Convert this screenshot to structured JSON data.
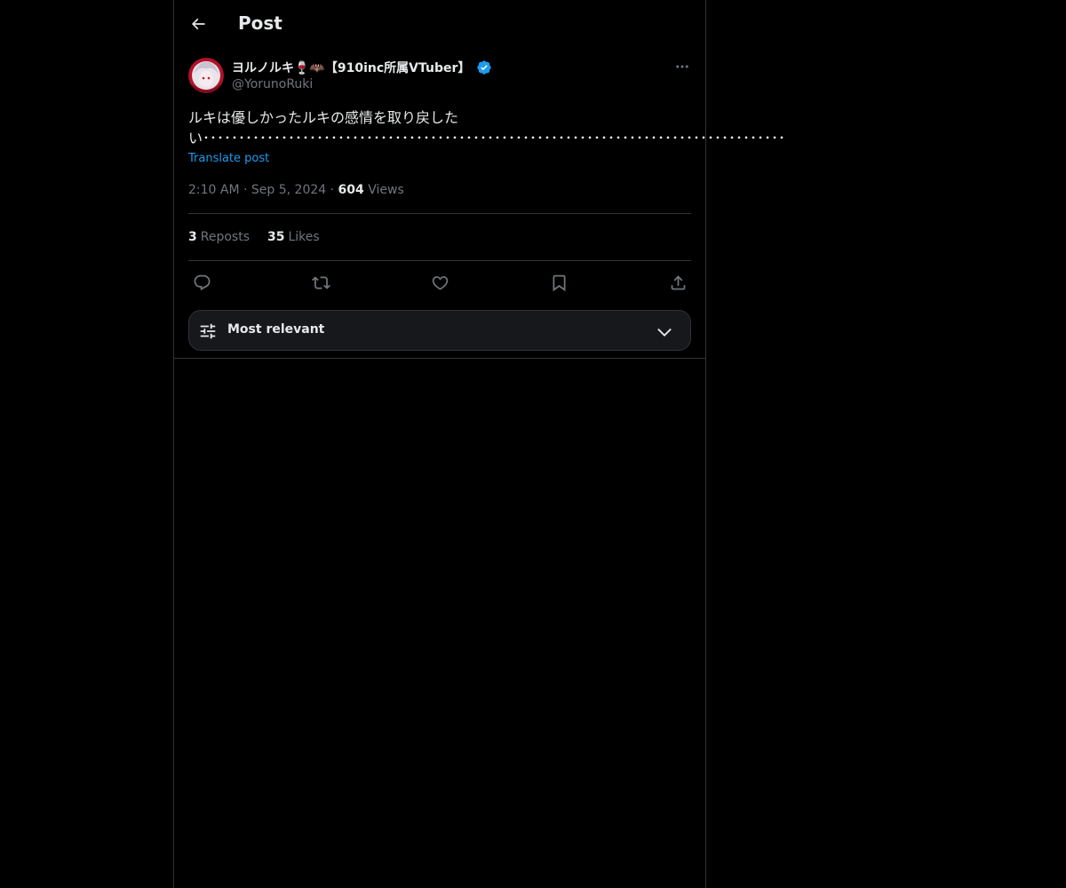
{
  "header": {
    "title": "Post",
    "back_icon": "arrow-left-icon"
  },
  "post": {
    "author": {
      "display_name": "ヨルノルキ🍷🦇【910inc所属VTuber】",
      "handle": "@YorunoRuki",
      "verified": true,
      "verified_color": "#1d9bf0"
    },
    "text": "ルキは優しかったルキの感情を取り戻したい･･････････････････････････････････････････････････････････････････････････････････",
    "translate_label": "Translate post",
    "time": "2:10 AM",
    "date": "Sep 5, 2024",
    "views_count": "604",
    "views_label": "Views",
    "reposts_count": "3",
    "reposts_label": "Reposts",
    "likes_count": "35",
    "likes_label": "Likes"
  },
  "actions": [
    "reply-icon",
    "repost-icon",
    "like-icon",
    "bookmark-icon",
    "share-icon"
  ],
  "sort": {
    "label": "Most relevant",
    "icon": "sliders-icon"
  },
  "colors": {
    "background": "#000000",
    "text": "#e7e9ea",
    "muted": "#71767b",
    "accent": "#1d9bf0",
    "border": "#2f3336"
  }
}
